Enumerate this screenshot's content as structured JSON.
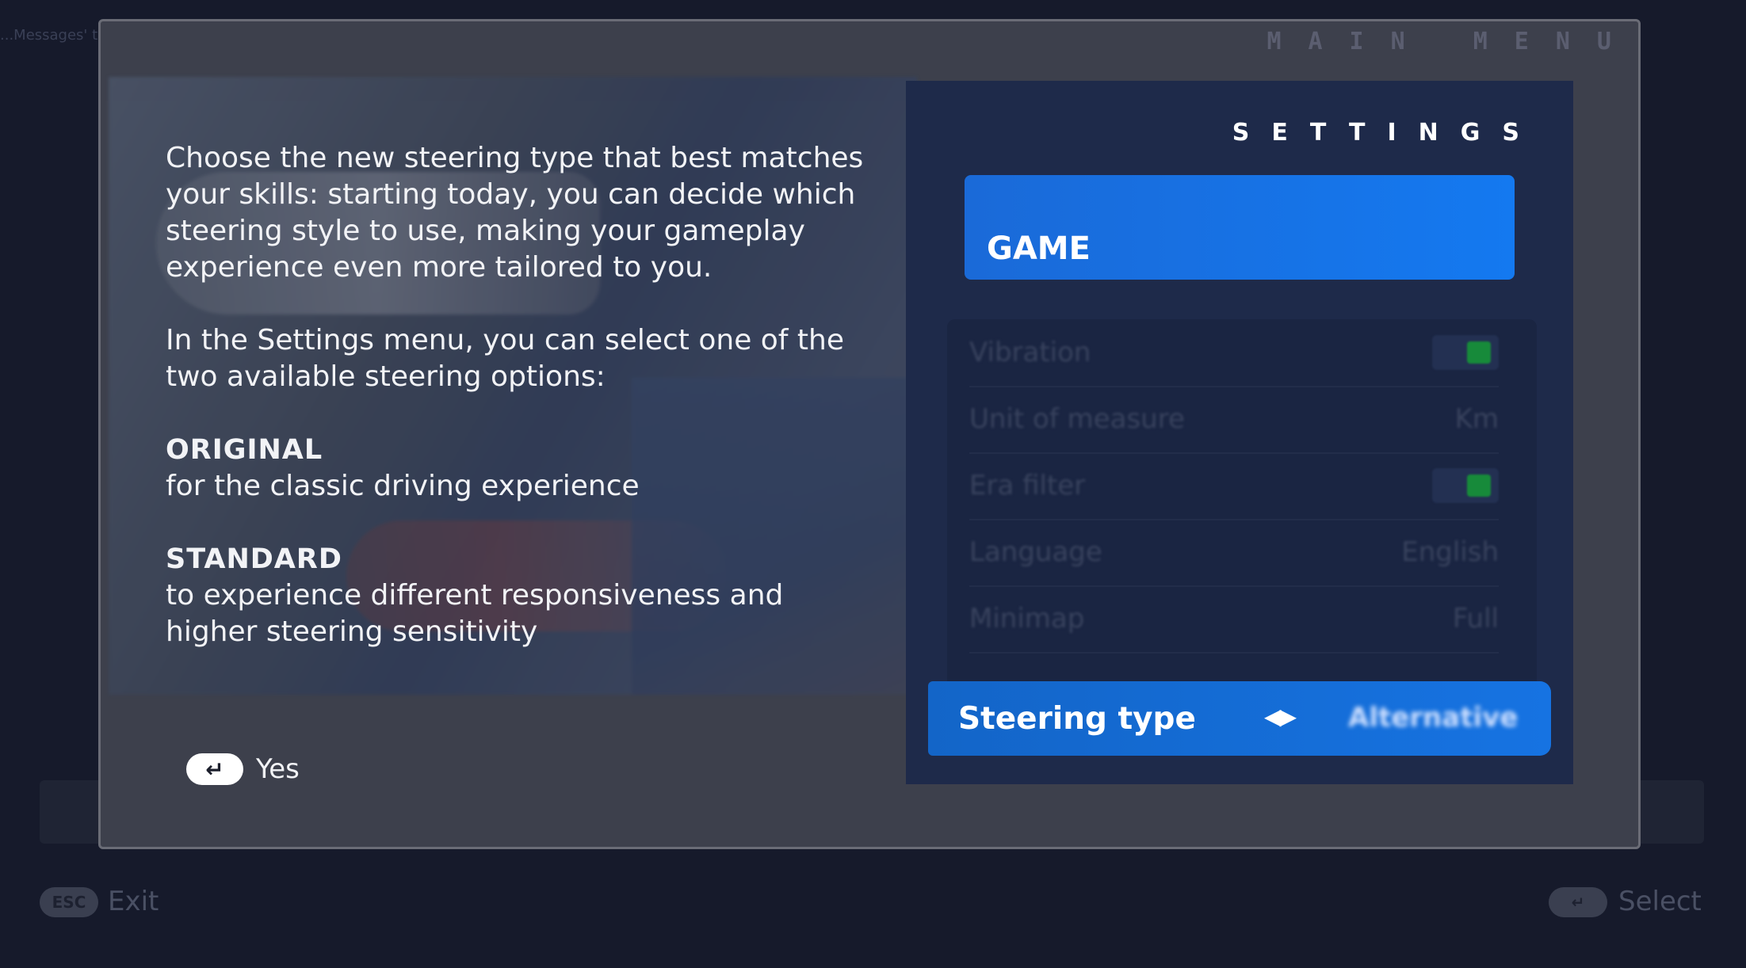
{
  "debug_text": "...Messages' to suppress",
  "modal": {
    "main_menu_title": "MAIN MENU",
    "description": {
      "paragraph1": "Choose the new steering type that best matches your skills: starting today, you can decide which steering style to use, making your gameplay experience even more tailored to you.",
      "paragraph2": "In the Settings menu, you can select one of the two available steering options:",
      "option1_title": "ORIGINAL",
      "option1_text": "for the classic driving experience",
      "option2_title": "STANDARD",
      "option2_text": "to experience different responsiveness and higher steering sensitivity"
    },
    "confirm": {
      "key_icon": "enter-key-icon",
      "label": "Yes"
    },
    "settings": {
      "title": "SETTINGS",
      "tab": "GAME",
      "rows": [
        {
          "label": "Vibration",
          "type": "toggle",
          "on": true
        },
        {
          "label": "Unit of measure",
          "value": "Km"
        },
        {
          "label": "Era filter",
          "type": "toggle",
          "on": true
        },
        {
          "label": "Language",
          "value": "English"
        },
        {
          "label": "Minimap",
          "value": "Full"
        }
      ],
      "steering": {
        "label": "Steering type",
        "value": "Alternative"
      }
    }
  },
  "bottom_bar": {
    "esc_key": "ESC",
    "exit_label": "Exit",
    "select_label": "Select"
  },
  "colors": {
    "accent": "#1479f0",
    "toggle_on": "#178a3a",
    "panel": "#1e2a4a"
  }
}
